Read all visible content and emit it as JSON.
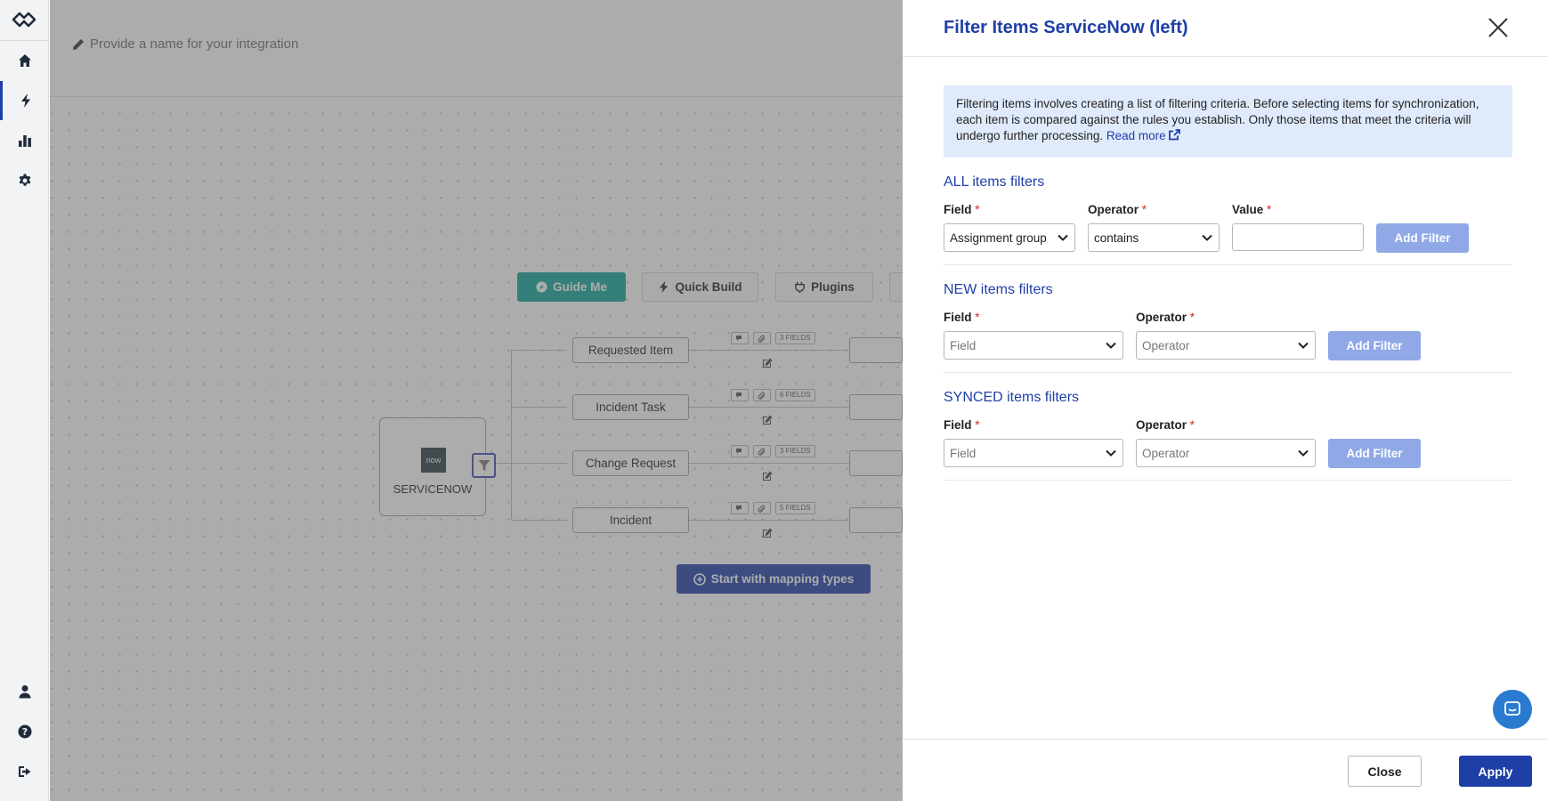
{
  "sidebar": {
    "items": [
      {
        "name": "home",
        "icon": "home-icon"
      },
      {
        "name": "integrations",
        "icon": "bolt-icon",
        "active": true
      },
      {
        "name": "reports",
        "icon": "bar-chart-icon"
      },
      {
        "name": "settings",
        "icon": "gear-icon"
      }
    ],
    "bottom": [
      {
        "name": "profile",
        "icon": "user-icon"
      },
      {
        "name": "help",
        "icon": "help-icon"
      },
      {
        "name": "logout",
        "icon": "logout-icon"
      }
    ]
  },
  "integration": {
    "name_placeholder": "Provide a name for your integration"
  },
  "toolbar": {
    "guide_me": "Guide Me",
    "quick_build": "Quick Build",
    "plugins": "Plugins"
  },
  "source": {
    "logo_text": "now",
    "label": "SERVICENOW"
  },
  "mapping_types": [
    {
      "label": "Requested Item",
      "fields": "3 FIELDS"
    },
    {
      "label": "Incident Task",
      "fields": "6 FIELDS"
    },
    {
      "label": "Change Request",
      "fields": "3 FIELDS"
    },
    {
      "label": "Incident",
      "fields": "5 FIELDS"
    }
  ],
  "start_mapping": "Start with mapping types",
  "drawer": {
    "title": "Filter Items ServiceNow (left)",
    "info_text": "Filtering items involves creating a list of filtering criteria. Before selecting items for synchronization, each item is compared against the rules you establish. Only those items that meet the criteria will undergo further processing.",
    "read_more": "Read more",
    "all": {
      "title": "ALL items filters",
      "field_label": "Field",
      "operator_label": "Operator",
      "value_label": "Value",
      "field_value": "Assignment group",
      "operator_value": "contains",
      "value_value": "",
      "add_label": "Add Filter"
    },
    "new": {
      "title": "NEW items filters",
      "field_label": "Field",
      "operator_label": "Operator",
      "field_placeholder": "Field",
      "operator_placeholder": "Operator",
      "add_label": "Add Filter"
    },
    "synced": {
      "title": "SYNCED items filters",
      "field_label": "Field",
      "operator_label": "Operator",
      "field_placeholder": "Field",
      "operator_placeholder": "Operator",
      "add_label": "Add Filter"
    },
    "required_mark": "*",
    "close_label": "Close",
    "apply_label": "Apply"
  },
  "colors": {
    "primary": "#1f3fa8",
    "teal": "#11a59a",
    "info_bg": "#dfeafb",
    "required": "#d12b2b",
    "disabled_button": "#90a8e6"
  }
}
